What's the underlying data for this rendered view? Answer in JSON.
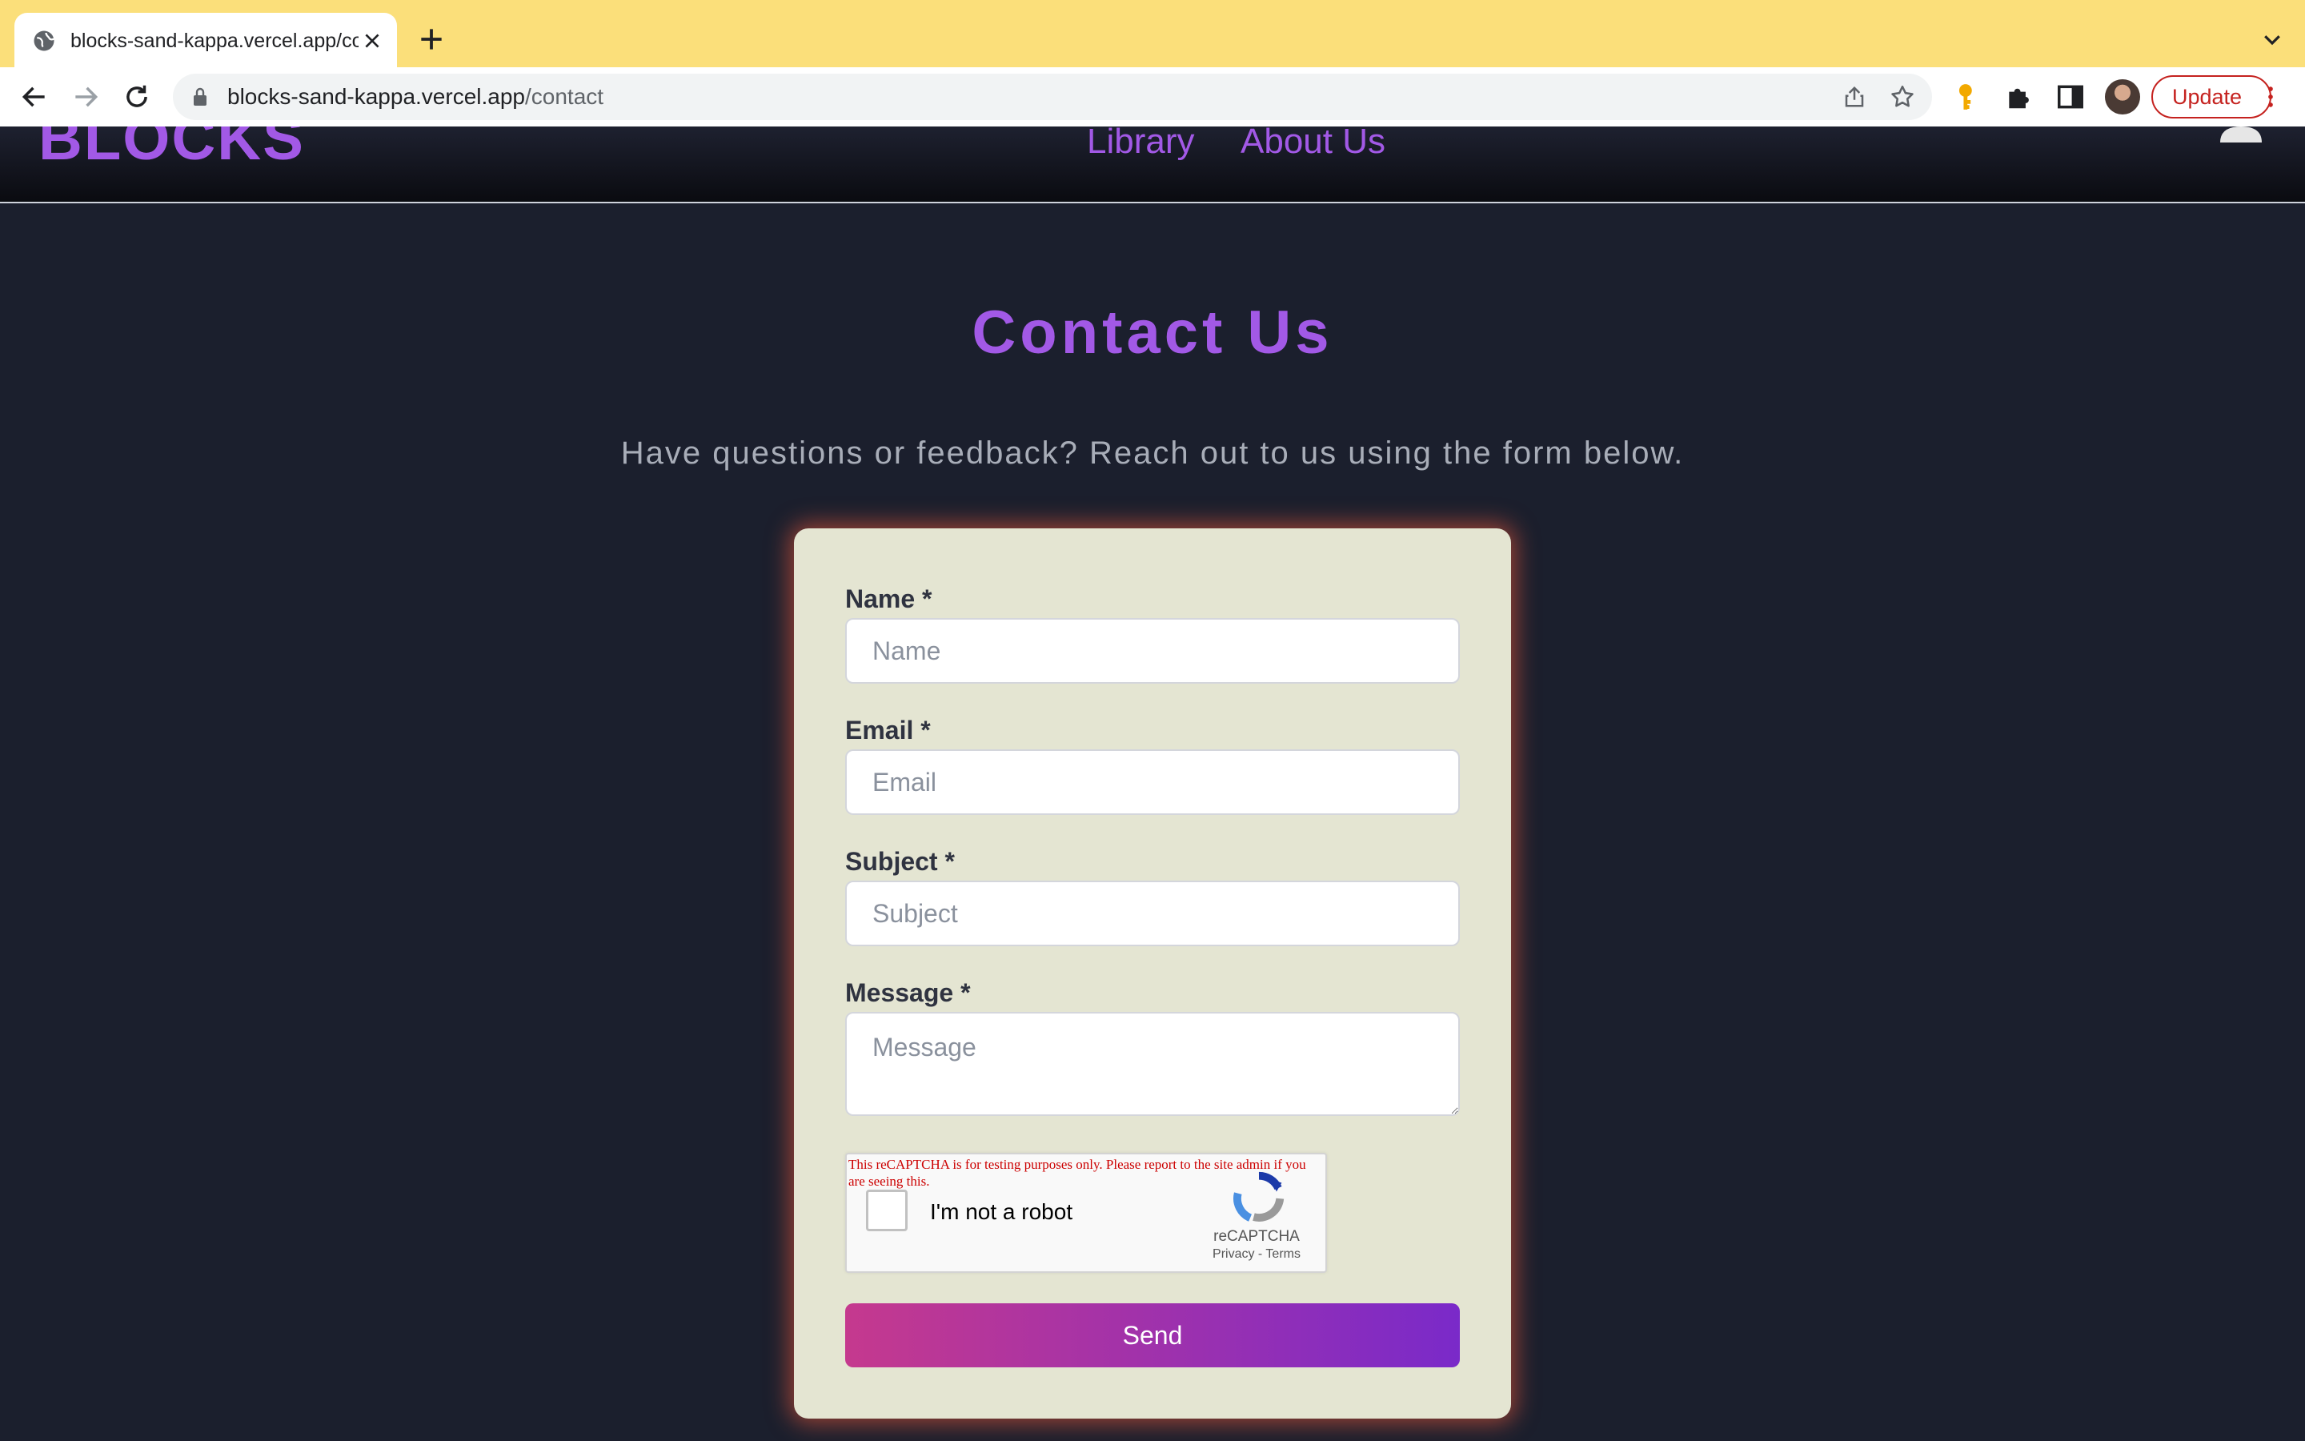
{
  "browser": {
    "tab_title": "blocks-sand-kappa.vercel.app/contact",
    "url_host": "blocks-sand-kappa.vercel.app",
    "url_path": "/contact",
    "update_label": "Update"
  },
  "header": {
    "logo": "BLOCKS",
    "nav": [
      "Library",
      "About Us"
    ]
  },
  "main": {
    "title": "Contact Us",
    "subtitle": "Have questions or feedback? Reach out to us using the form below."
  },
  "form": {
    "name": {
      "label": "Name *",
      "placeholder": "Name"
    },
    "email": {
      "label": "Email *",
      "placeholder": "Email"
    },
    "subject": {
      "label": "Subject *",
      "placeholder": "Subject"
    },
    "message": {
      "label": "Message *",
      "placeholder": "Message"
    },
    "recaptcha": {
      "warning": "This reCAPTCHA is for testing purposes only. Please report to the site admin if you are seeing this.",
      "label": "I'm not a robot",
      "brand": "reCAPTCHA",
      "links": "Privacy - Terms"
    },
    "submit": "Send"
  },
  "colors": {
    "accent": "#a259e6",
    "tab_strip": "#fbdf7a",
    "page_bg": "#1b1f2d",
    "card_bg": "#e4e5d2",
    "button_gradient": [
      "#c5398e",
      "#7a2ac9"
    ]
  }
}
